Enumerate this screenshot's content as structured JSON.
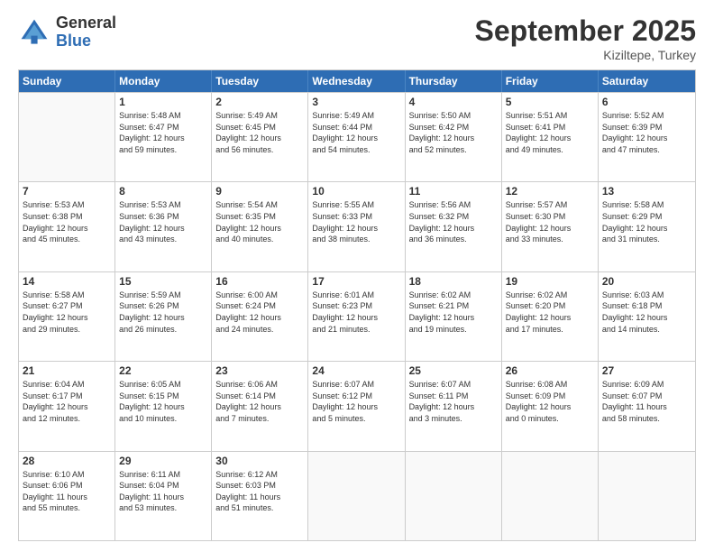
{
  "logo": {
    "general": "General",
    "blue": "Blue"
  },
  "header": {
    "title": "September 2025",
    "subtitle": "Kiziltepe, Turkey"
  },
  "days": [
    "Sunday",
    "Monday",
    "Tuesday",
    "Wednesday",
    "Thursday",
    "Friday",
    "Saturday"
  ],
  "weeks": [
    [
      {
        "day": "",
        "lines": []
      },
      {
        "day": "1",
        "lines": [
          "Sunrise: 5:48 AM",
          "Sunset: 6:47 PM",
          "Daylight: 12 hours",
          "and 59 minutes."
        ]
      },
      {
        "day": "2",
        "lines": [
          "Sunrise: 5:49 AM",
          "Sunset: 6:45 PM",
          "Daylight: 12 hours",
          "and 56 minutes."
        ]
      },
      {
        "day": "3",
        "lines": [
          "Sunrise: 5:49 AM",
          "Sunset: 6:44 PM",
          "Daylight: 12 hours",
          "and 54 minutes."
        ]
      },
      {
        "day": "4",
        "lines": [
          "Sunrise: 5:50 AM",
          "Sunset: 6:42 PM",
          "Daylight: 12 hours",
          "and 52 minutes."
        ]
      },
      {
        "day": "5",
        "lines": [
          "Sunrise: 5:51 AM",
          "Sunset: 6:41 PM",
          "Daylight: 12 hours",
          "and 49 minutes."
        ]
      },
      {
        "day": "6",
        "lines": [
          "Sunrise: 5:52 AM",
          "Sunset: 6:39 PM",
          "Daylight: 12 hours",
          "and 47 minutes."
        ]
      }
    ],
    [
      {
        "day": "7",
        "lines": [
          "Sunrise: 5:53 AM",
          "Sunset: 6:38 PM",
          "Daylight: 12 hours",
          "and 45 minutes."
        ]
      },
      {
        "day": "8",
        "lines": [
          "Sunrise: 5:53 AM",
          "Sunset: 6:36 PM",
          "Daylight: 12 hours",
          "and 43 minutes."
        ]
      },
      {
        "day": "9",
        "lines": [
          "Sunrise: 5:54 AM",
          "Sunset: 6:35 PM",
          "Daylight: 12 hours",
          "and 40 minutes."
        ]
      },
      {
        "day": "10",
        "lines": [
          "Sunrise: 5:55 AM",
          "Sunset: 6:33 PM",
          "Daylight: 12 hours",
          "and 38 minutes."
        ]
      },
      {
        "day": "11",
        "lines": [
          "Sunrise: 5:56 AM",
          "Sunset: 6:32 PM",
          "Daylight: 12 hours",
          "and 36 minutes."
        ]
      },
      {
        "day": "12",
        "lines": [
          "Sunrise: 5:57 AM",
          "Sunset: 6:30 PM",
          "Daylight: 12 hours",
          "and 33 minutes."
        ]
      },
      {
        "day": "13",
        "lines": [
          "Sunrise: 5:58 AM",
          "Sunset: 6:29 PM",
          "Daylight: 12 hours",
          "and 31 minutes."
        ]
      }
    ],
    [
      {
        "day": "14",
        "lines": [
          "Sunrise: 5:58 AM",
          "Sunset: 6:27 PM",
          "Daylight: 12 hours",
          "and 29 minutes."
        ]
      },
      {
        "day": "15",
        "lines": [
          "Sunrise: 5:59 AM",
          "Sunset: 6:26 PM",
          "Daylight: 12 hours",
          "and 26 minutes."
        ]
      },
      {
        "day": "16",
        "lines": [
          "Sunrise: 6:00 AM",
          "Sunset: 6:24 PM",
          "Daylight: 12 hours",
          "and 24 minutes."
        ]
      },
      {
        "day": "17",
        "lines": [
          "Sunrise: 6:01 AM",
          "Sunset: 6:23 PM",
          "Daylight: 12 hours",
          "and 21 minutes."
        ]
      },
      {
        "day": "18",
        "lines": [
          "Sunrise: 6:02 AM",
          "Sunset: 6:21 PM",
          "Daylight: 12 hours",
          "and 19 minutes."
        ]
      },
      {
        "day": "19",
        "lines": [
          "Sunrise: 6:02 AM",
          "Sunset: 6:20 PM",
          "Daylight: 12 hours",
          "and 17 minutes."
        ]
      },
      {
        "day": "20",
        "lines": [
          "Sunrise: 6:03 AM",
          "Sunset: 6:18 PM",
          "Daylight: 12 hours",
          "and 14 minutes."
        ]
      }
    ],
    [
      {
        "day": "21",
        "lines": [
          "Sunrise: 6:04 AM",
          "Sunset: 6:17 PM",
          "Daylight: 12 hours",
          "and 12 minutes."
        ]
      },
      {
        "day": "22",
        "lines": [
          "Sunrise: 6:05 AM",
          "Sunset: 6:15 PM",
          "Daylight: 12 hours",
          "and 10 minutes."
        ]
      },
      {
        "day": "23",
        "lines": [
          "Sunrise: 6:06 AM",
          "Sunset: 6:14 PM",
          "Daylight: 12 hours",
          "and 7 minutes."
        ]
      },
      {
        "day": "24",
        "lines": [
          "Sunrise: 6:07 AM",
          "Sunset: 6:12 PM",
          "Daylight: 12 hours",
          "and 5 minutes."
        ]
      },
      {
        "day": "25",
        "lines": [
          "Sunrise: 6:07 AM",
          "Sunset: 6:11 PM",
          "Daylight: 12 hours",
          "and 3 minutes."
        ]
      },
      {
        "day": "26",
        "lines": [
          "Sunrise: 6:08 AM",
          "Sunset: 6:09 PM",
          "Daylight: 12 hours",
          "and 0 minutes."
        ]
      },
      {
        "day": "27",
        "lines": [
          "Sunrise: 6:09 AM",
          "Sunset: 6:07 PM",
          "Daylight: 11 hours",
          "and 58 minutes."
        ]
      }
    ],
    [
      {
        "day": "28",
        "lines": [
          "Sunrise: 6:10 AM",
          "Sunset: 6:06 PM",
          "Daylight: 11 hours",
          "and 55 minutes."
        ]
      },
      {
        "day": "29",
        "lines": [
          "Sunrise: 6:11 AM",
          "Sunset: 6:04 PM",
          "Daylight: 11 hours",
          "and 53 minutes."
        ]
      },
      {
        "day": "30",
        "lines": [
          "Sunrise: 6:12 AM",
          "Sunset: 6:03 PM",
          "Daylight: 11 hours",
          "and 51 minutes."
        ]
      },
      {
        "day": "",
        "lines": []
      },
      {
        "day": "",
        "lines": []
      },
      {
        "day": "",
        "lines": []
      },
      {
        "day": "",
        "lines": []
      }
    ]
  ]
}
